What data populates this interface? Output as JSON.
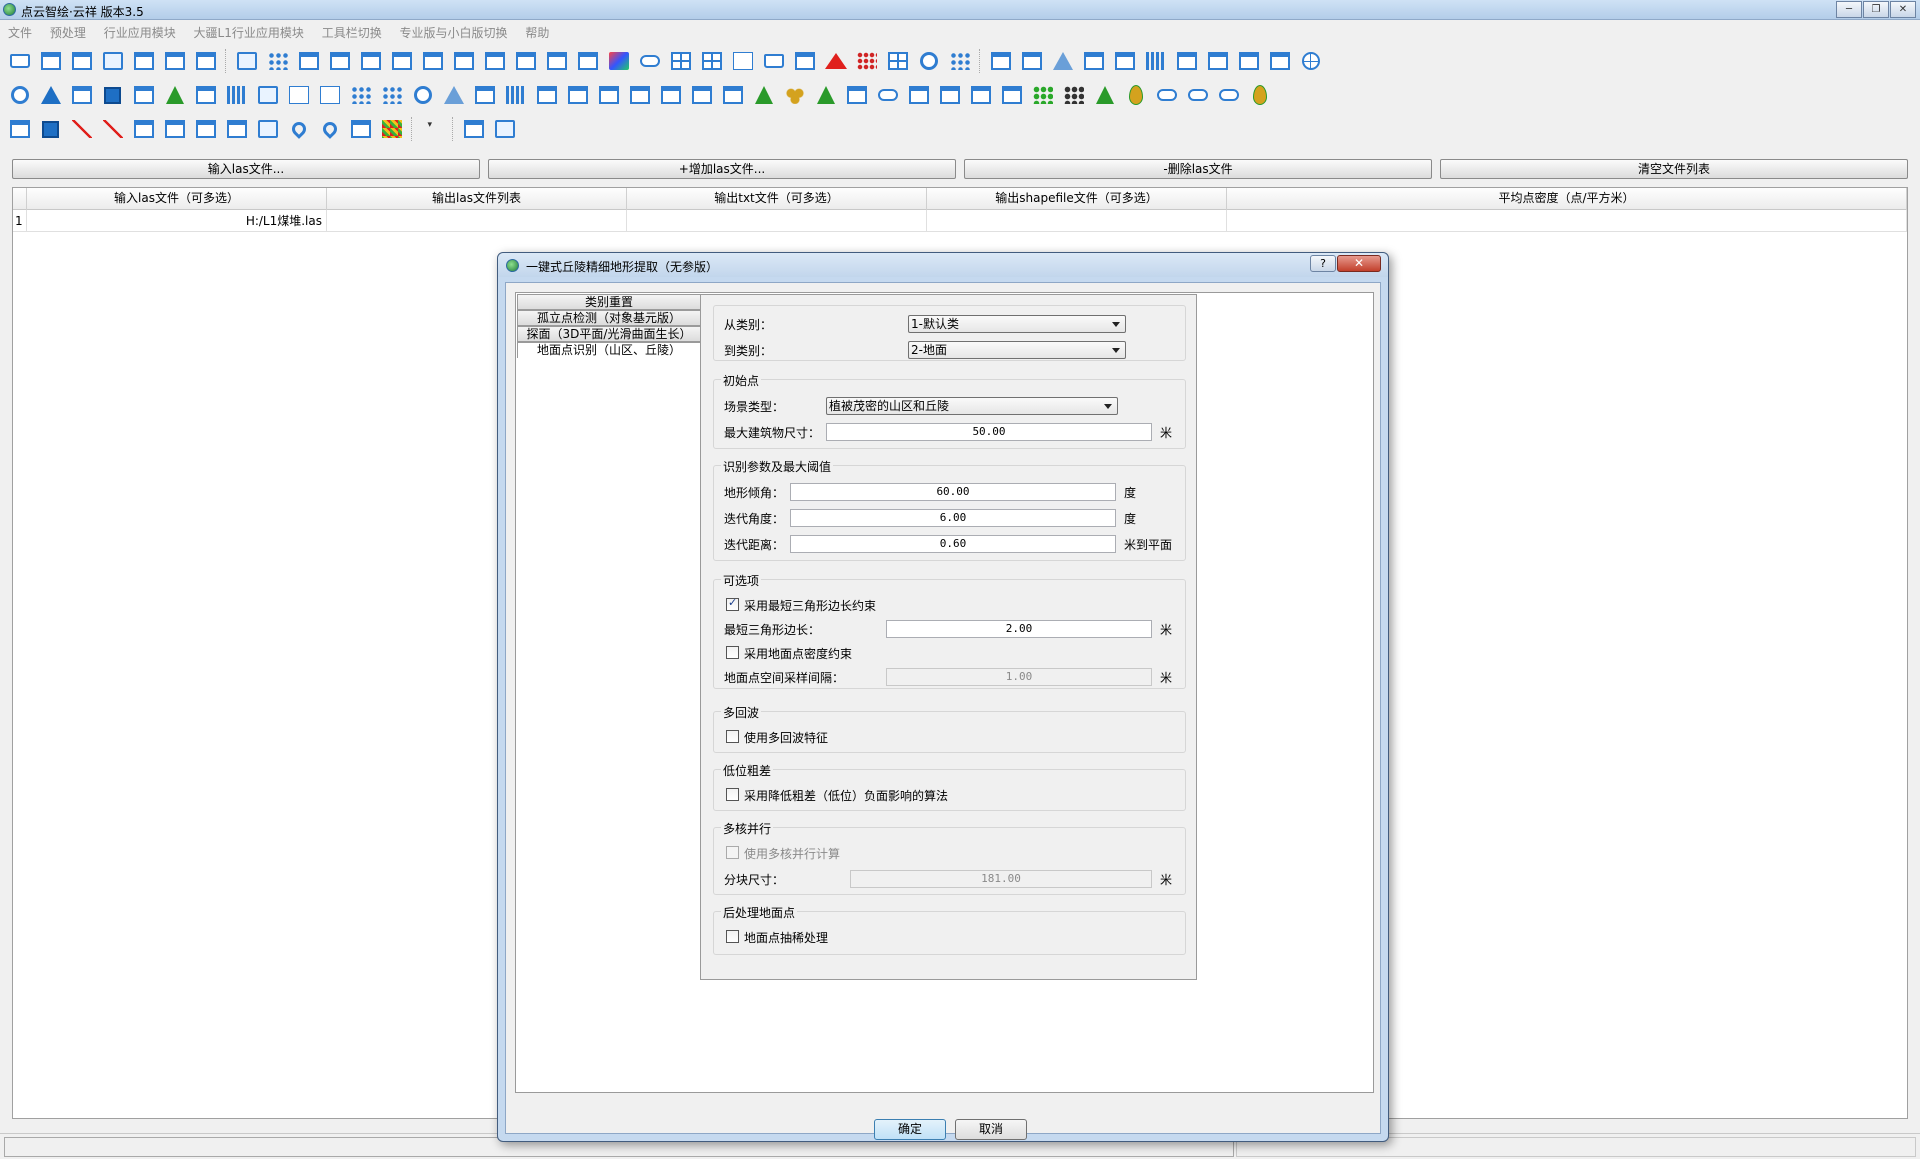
{
  "window": {
    "title": "点云智绘·云祥 版本3.5",
    "buttons": [
      "─",
      "❐",
      "✕"
    ]
  },
  "menu": [
    "文件",
    "预处理",
    "行业应用模块",
    "大疆L1行业应用模块",
    "工具栏切换",
    "专业版与小白版切换",
    "帮助"
  ],
  "file_buttons": {
    "input": "输入las文件...",
    "add": "+增加las文件...",
    "delete": "-删除las文件",
    "clear": "清空文件列表"
  },
  "table": {
    "headers": [
      "输入las文件（可多选）",
      "输出las文件列表",
      "输出txt文件（可多选）",
      "输出shapefile文件（可多选）",
      "平均点密度（点/平方米）"
    ],
    "rows": [
      {
        "index": "1",
        "input": "H:/L1煤堆.las",
        "output_las": "",
        "output_txt": "",
        "output_shp": "",
        "density": ""
      }
    ]
  },
  "dialog": {
    "title": "一键式丘陵精细地形提取（无参版）",
    "help": "?",
    "close": "✕",
    "tabs": [
      "类别重置",
      "孤立点检测（对象基元版）",
      "探面（3D平面/光滑曲面生长）",
      "地面点识别（山区、丘陵）"
    ],
    "from_class_label": "从类别：",
    "from_class_value": "1-默认类",
    "to_class_label": "到类别：",
    "to_class_value": "2-地面",
    "initial": {
      "title": "初始点",
      "scene_label": "场景类型：",
      "scene_value": "植被茂密的山区和丘陵",
      "max_building_label": "最大建筑物尺寸：",
      "max_building_value": "50.00",
      "max_building_unit": "米"
    },
    "params": {
      "title": "识别参数及最大阈值",
      "slope_label": "地形倾角：",
      "slope_value": "60.00",
      "slope_unit": "度",
      "iter_angle_label": "迭代角度：",
      "iter_angle_value": "6.00",
      "iter_angle_unit": "度",
      "iter_dist_label": "迭代距离：",
      "iter_dist_value": "0.60",
      "iter_dist_unit": "米到平面"
    },
    "optional": {
      "title": "可选项",
      "cb1_label": "采用最短三角形边长约束",
      "cb1_checked": true,
      "edge_label": "最短三角形边长：",
      "edge_value": "2.00",
      "edge_unit": "米",
      "cb2_label": "采用地面点密度约束",
      "cb2_checked": false,
      "spacing_label": "地面点空间采样间隔：",
      "spacing_value": "1.00",
      "spacing_unit": "米"
    },
    "multi_return": {
      "title": "多回波",
      "cb_label": "使用多回波特征",
      "checked": false
    },
    "low_outlier": {
      "title": "低位粗差",
      "cb_label": "采用降低粗差（低位）负面影响的算法",
      "checked": false
    },
    "parallel": {
      "title": "多核并行",
      "cb_label": "使用多核并行计算",
      "checked": false,
      "block_label": "分块尺寸：",
      "block_value": "181.00",
      "block_unit": "米"
    },
    "post": {
      "title": "后处理地面点",
      "cb_label": "地面点抽稀处理",
      "checked": false
    },
    "ok": "确定",
    "cancel": "取消"
  },
  "toolbar_icons": {
    "row1": [
      "open-folder-icon",
      "import-icon",
      "export-icon",
      "copy-doc-icon",
      "edit-icon",
      "open-icon",
      "open-2-icon",
      "document-icon",
      "scatter-icon",
      "merge-icon",
      "split-icon",
      "export-2-icon",
      "arrow-icon",
      "crop-icon",
      "crop-2-icon",
      "trim-icon",
      "max-icon",
      "min-icon",
      "compare-icon",
      "cube-icon",
      "cloud-icon",
      "grid-icon",
      "split-grid-icon",
      "dsm-icon",
      "folder-icon",
      "polygon-icon",
      "elevation-icon",
      "red-dots-icon",
      "grid-2-icon",
      "target-icon",
      "scatter-2-icon",
      "person-icon",
      "person-2-icon",
      "triangle-icon",
      "search-icon",
      "curve-icon",
      "histogram-icon",
      "profile-icon",
      "terrain-icon",
      "cancel-circle-icon",
      "chart-icon",
      "globe-icon"
    ],
    "row2": [
      "ring-icon",
      "cone-icon",
      "frame-icon",
      "square-icon",
      "image-icon",
      "tree-icon",
      "segment-icon",
      "waveform-icon",
      "doc-x-icon",
      "kmeans-icon",
      "knn-icon",
      "dots-icon",
      "scatter-3-icon",
      "ring-2-icon",
      "triangle-2-icon",
      "palette-icon",
      "bar-chart-icon",
      "zoom-icon",
      "zoom-2-icon",
      "export-3-icon",
      "swirl-icon",
      "search-2-icon",
      "car-icon",
      "house-icon",
      "tree-leaf-icon",
      "bush-icon",
      "forest-icon",
      "upload-icon",
      "cloud-2-icon",
      "column-icon",
      "column-2-icon",
      "hex-icon",
      "hex-2-icon",
      "color-dots-icon",
      "black-dots-icon",
      "green-tree-icon",
      "leaf-icon",
      "cloud-3-icon",
      "cloud-4-icon",
      "cloud-5-icon",
      "leaf-2-icon"
    ],
    "row3": [
      "search-3-icon",
      "box-icon",
      "line-red-icon",
      "line-red-2-icon",
      "branch-icon",
      "shape-icon",
      "measure-icon",
      "swirl-2-icon",
      "doc-zoom-icon",
      "map-pin-icon",
      "location-icon",
      "layers-icon",
      "color-map-icon",
      "dropdown-icon",
      "person-card-icon",
      "list-doc-icon"
    ]
  }
}
